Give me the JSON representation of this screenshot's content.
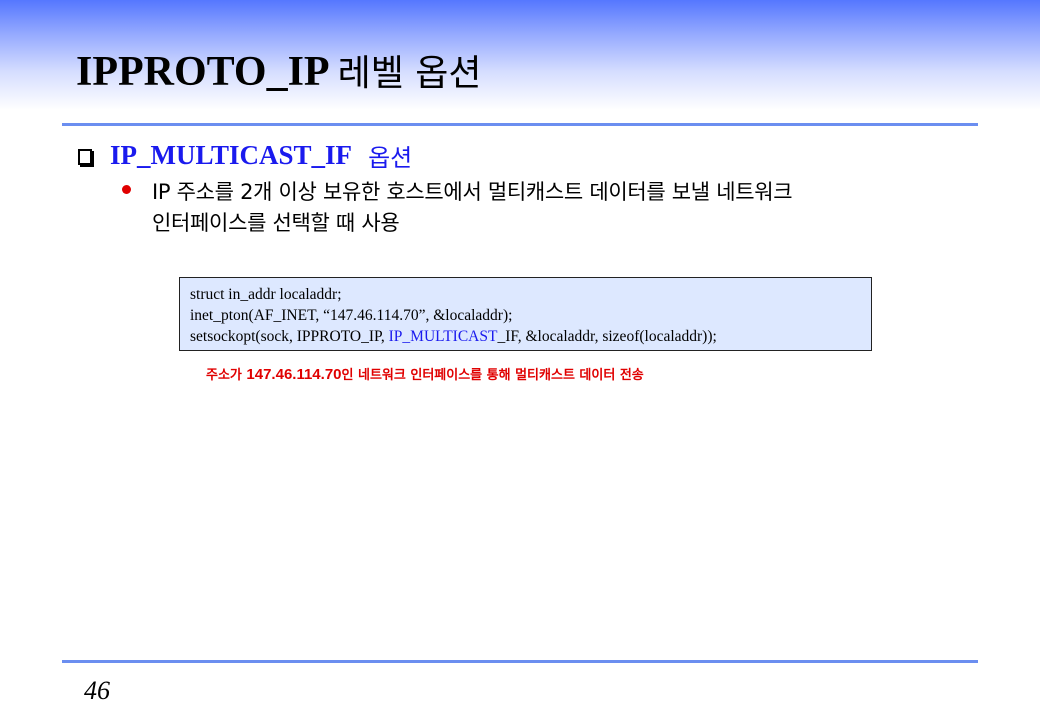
{
  "slide": {
    "title": "IPPROTO_IP",
    "title_kr": "레벨 옵션",
    "bullet1": {
      "heading": "IP_MULTICAST_IF",
      "heading_kr": "옵션"
    },
    "bullet2": {
      "line1": "IP 주소를 2개 이상 보유한 호스트에서 멀티캐스트 데이터를 보낼 네트워크",
      "line2": "인터페이스를 선택할 때 사용"
    },
    "code": {
      "line1": "struct in_addr localaddr;",
      "line2": "inet_pton(AF_INET, “147.46.114.70”,  &localaddr);",
      "line3_prefix": "setsockopt(sock, IPPROTO_IP, ",
      "line3_highlight": "IP_MULTICAST",
      "line3_suffix": "_IF, &localaddr, sizeof(localaddr));"
    },
    "caption": {
      "prefix": "주소가 ",
      "ip": "147.46.114.70",
      "suffix": "인 네트워크  인터페이스를  통해  멀티캐스트  데이터  전송"
    },
    "page_number": "46"
  },
  "colors": {
    "accent_blue": "#1a1aee",
    "rule_blue": "#6b8ef0",
    "caption_red": "#e00000",
    "code_bg": "#dde8ff"
  },
  "icons": {
    "bullet1": "hollow-square-icon",
    "bullet2": "red-dot-icon"
  }
}
